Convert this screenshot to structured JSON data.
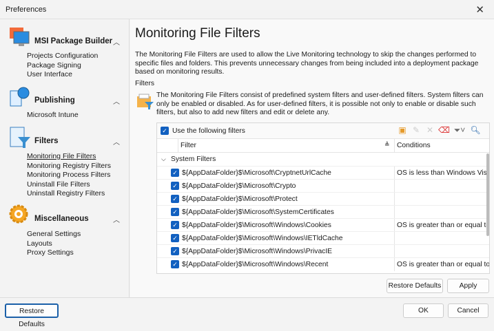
{
  "window": {
    "title": "Preferences",
    "close_icon": "close-icon"
  },
  "sidebar": {
    "groups": [
      {
        "title": "MSI Package Builder",
        "icon": "monitor-icon",
        "items": [
          "Projects Configuration",
          "Package Signing",
          "User Interface"
        ]
      },
      {
        "title": "Publishing",
        "icon": "publish-globe-icon",
        "items": [
          "Microsoft Intune"
        ]
      },
      {
        "title": "Filters",
        "icon": "filter-document-icon",
        "items": [
          "Monitoring File Filters",
          "Monitoring Registry Filters",
          "Monitoring Process Filters",
          "Uninstall File Filters",
          "Uninstall Registry Filters"
        ],
        "selected": 0
      },
      {
        "title": "Miscellaneous",
        "icon": "gear-icon",
        "items": [
          "General Settings",
          "Layouts",
          "Proxy Settings"
        ]
      }
    ]
  },
  "main": {
    "title": "Monitoring File Filters",
    "description": "The Monitoring File Filters are used to allow the Live Monitoring technology to skip the changes performed to specific files and folders. This prevents unnecessary changes from being included into a deployment package based on monitoring results.",
    "section_label": "Filters",
    "info": "The Monitoring File Filters consist of predefined system filters and user-defined filters. System filters can only be enabled or disabled. As for user-defined filters, it is possible not only to enable or disable such filters, but also to add new filters and edit or delete any.",
    "grid": {
      "use_filters_label": "Use the following filters",
      "use_filters_checked": true,
      "columns": [
        "Filter",
        "Conditions"
      ],
      "group": "System Filters",
      "rows": [
        {
          "filter": "${AppDataFolder}$\\Microsoft\\CryptnetUrlCache",
          "condition": "OS is less than Windows Vista",
          "checked": true
        },
        {
          "filter": "${AppDataFolder}$\\Microsoft\\Crypto",
          "condition": "",
          "checked": true
        },
        {
          "filter": "${AppDataFolder}$\\Microsoft\\Protect",
          "condition": "",
          "checked": true
        },
        {
          "filter": "${AppDataFolder}$\\Microsoft\\SystemCertificates",
          "condition": "",
          "checked": true
        },
        {
          "filter": "${AppDataFolder}$\\Microsoft\\Windows\\Cookies",
          "condition": "OS is greater than or equal to W",
          "checked": true
        },
        {
          "filter": "${AppDataFolder}$\\Microsoft\\Windows\\IETldCache",
          "condition": "",
          "checked": true
        },
        {
          "filter": "${AppDataFolder}$\\Microsoft\\Windows\\PrivacIE",
          "condition": "",
          "checked": true
        },
        {
          "filter": "${AppDataFolder}$\\Microsoft\\Windows\\Recent",
          "condition": "OS is greater than or equal to W",
          "checked": true
        }
      ]
    },
    "restore_label": "Restore Defaults",
    "apply_label": "Apply"
  },
  "footer": {
    "restore_label": "Restore Defaults",
    "ok_label": "OK",
    "cancel_label": "Cancel"
  }
}
